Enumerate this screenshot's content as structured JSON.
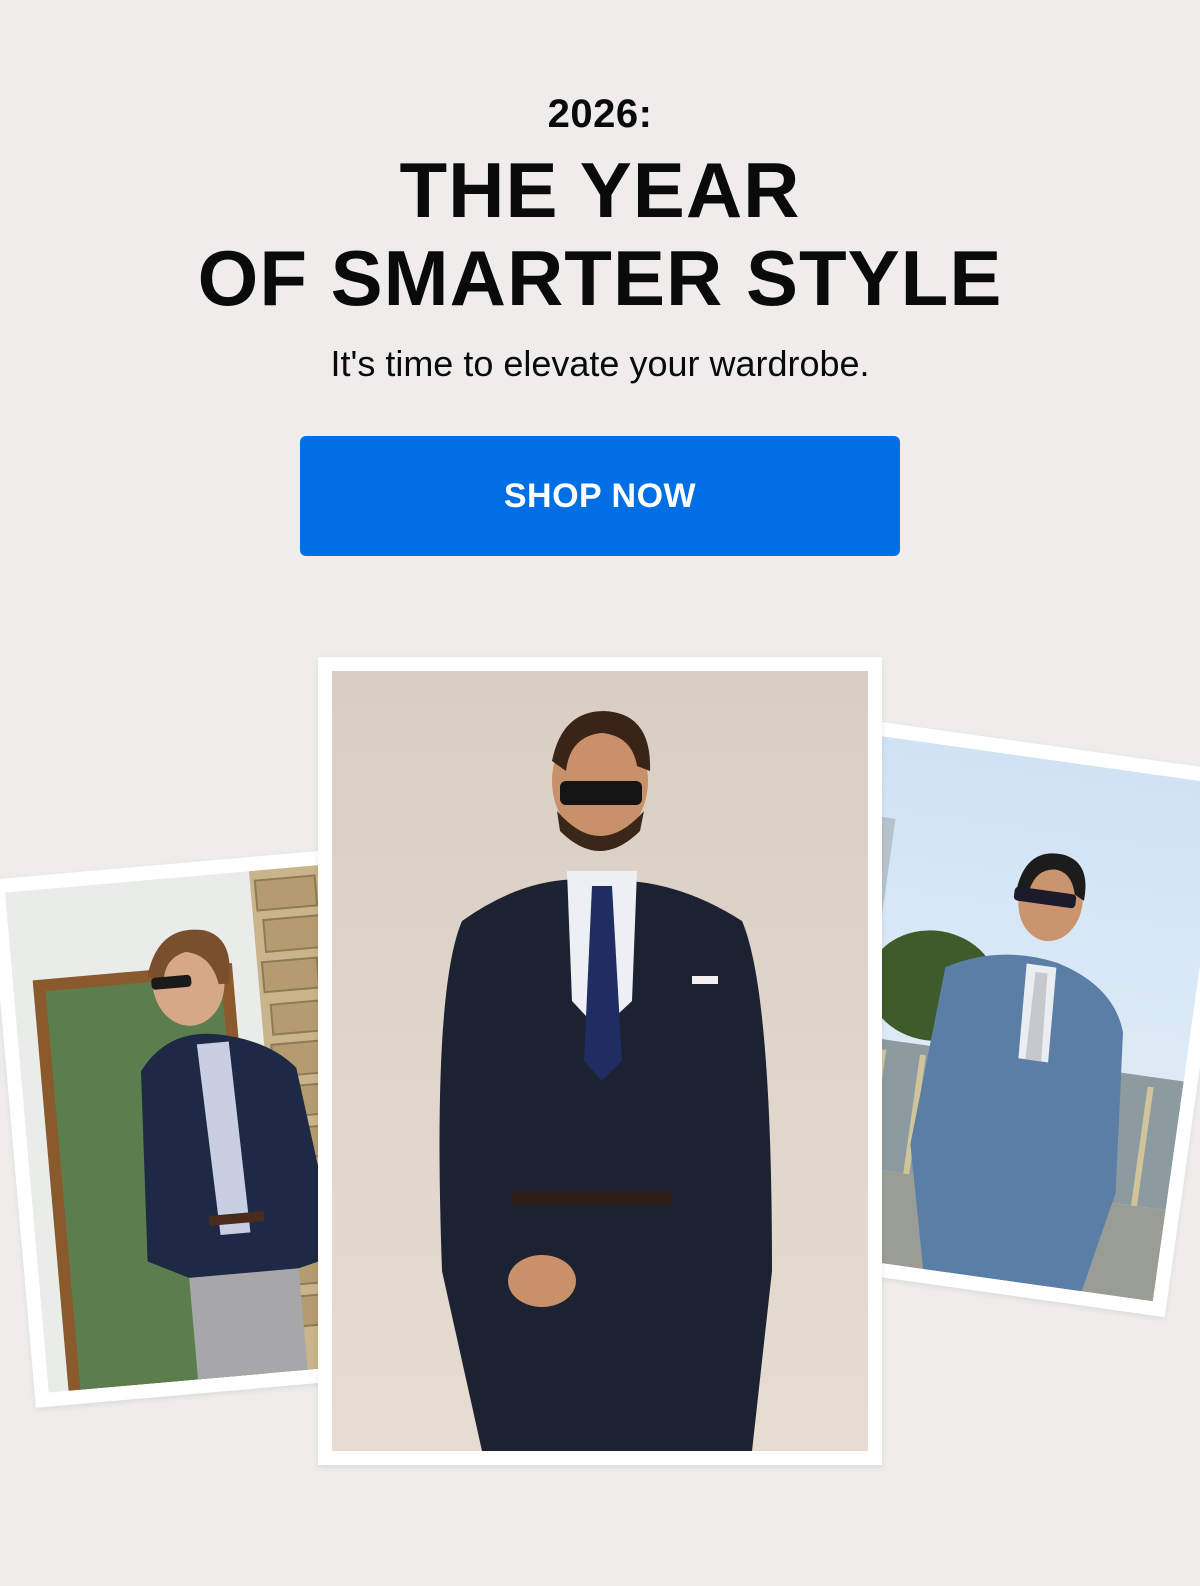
{
  "hero": {
    "eyebrow": "2026:",
    "headline_line1": "THE YEAR",
    "headline_line2": "OF SMARTER STYLE",
    "subhead": "It's time to elevate your wardrobe.",
    "cta_label": "SHOP NOW"
  },
  "colors": {
    "background": "#eeedeb",
    "cta": "#006ee5",
    "cta_text": "#ffffff",
    "text": "#0a0a0a"
  },
  "photos": [
    {
      "name": "left-photo",
      "subject": "man in navy blazer and grey trousers by stone wall"
    },
    {
      "name": "center-photo",
      "subject": "man in navy suit with sunglasses"
    },
    {
      "name": "right-photo",
      "subject": "man in light blue suit with sunglasses"
    }
  ]
}
